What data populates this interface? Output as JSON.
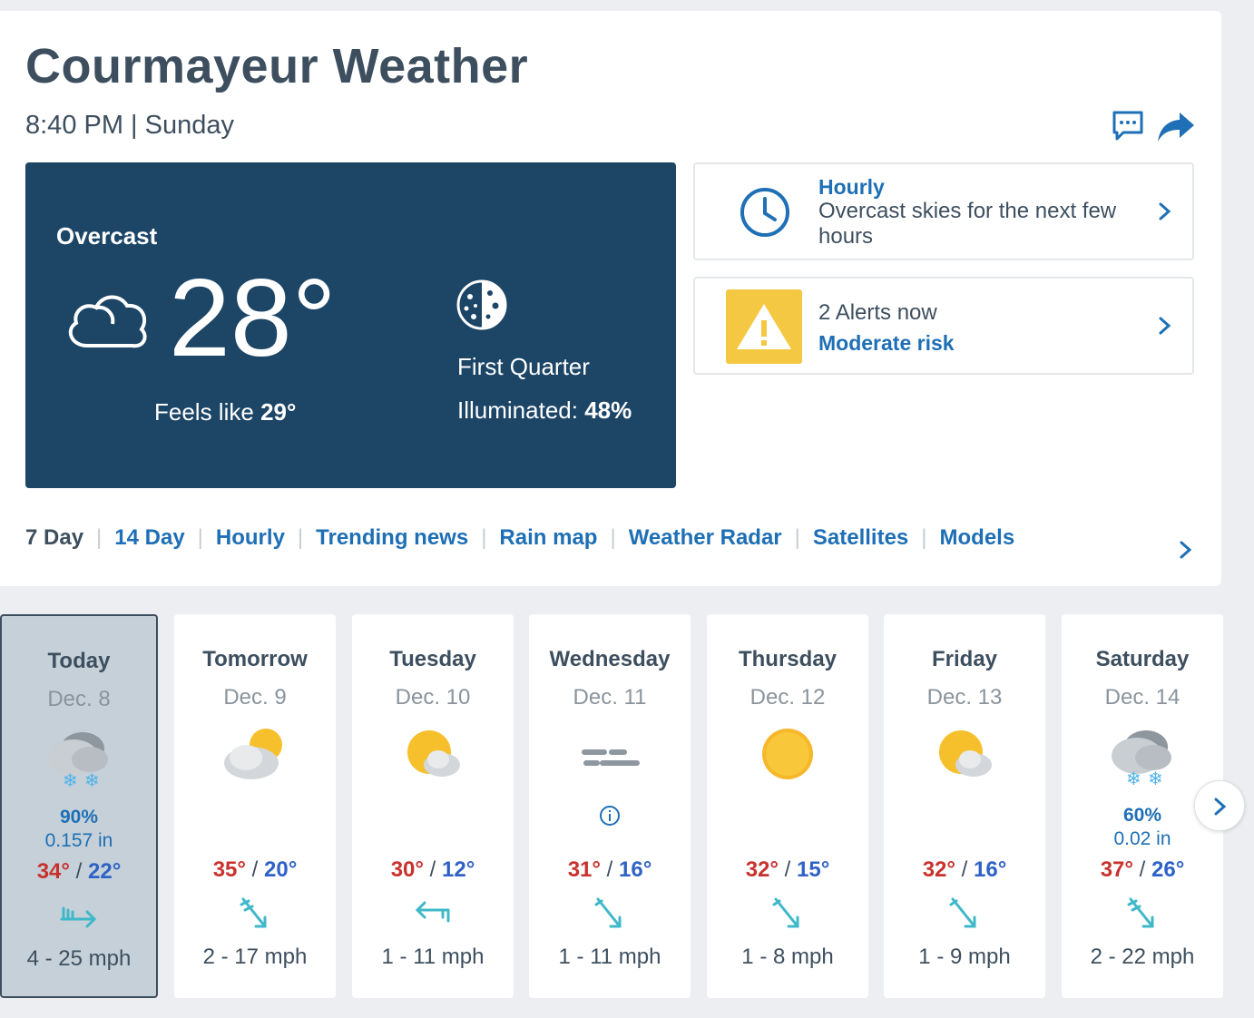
{
  "header": {
    "title": "Courmayeur Weather",
    "time_line": "8:40 PM | Sunday"
  },
  "current": {
    "condition": "Overcast",
    "temperature": "28°",
    "feels_like_label": "Feels like",
    "feels_like_value": "29°",
    "moon_phase": "First Quarter",
    "illuminated_label": "Illuminated:",
    "illuminated_value": "48%"
  },
  "hourly_card": {
    "title": "Hourly",
    "description": "Overcast skies for the next few hours"
  },
  "alerts_card": {
    "count_text": "2 Alerts now",
    "risk_text": "Moderate risk"
  },
  "tabs": [
    "7 Day",
    "14 Day",
    "Hourly",
    "Trending news",
    "Rain map",
    "Weather Radar",
    "Satellites",
    "Models"
  ],
  "forecast": [
    {
      "day": "Today",
      "date": "Dec. 8",
      "icon": "snow-cloud-icon",
      "precip_pct": "90%",
      "precip_amt": "0.157 in",
      "hi": "34°",
      "lo": "22°",
      "wind": "4 - 25 mph"
    },
    {
      "day": "Tomorrow",
      "date": "Dec. 9",
      "icon": "partly-cloudy-icon",
      "hi": "35°",
      "lo": "20°",
      "wind": "2 - 17 mph"
    },
    {
      "day": "Tuesday",
      "date": "Dec. 10",
      "icon": "sun-cloud-icon",
      "hi": "30°",
      "lo": "12°",
      "wind": "1 - 11 mph"
    },
    {
      "day": "Wednesday",
      "date": "Dec. 11",
      "icon": "fog-icon",
      "hi": "31°",
      "lo": "16°",
      "wind": "1 - 11 mph"
    },
    {
      "day": "Thursday",
      "date": "Dec. 12",
      "icon": "sun-icon",
      "hi": "32°",
      "lo": "15°",
      "wind": "1 - 8 mph"
    },
    {
      "day": "Friday",
      "date": "Dec. 13",
      "icon": "sun-cloud-icon",
      "hi": "32°",
      "lo": "16°",
      "wind": "1 - 9 mph"
    },
    {
      "day": "Saturday",
      "date": "Dec. 14",
      "icon": "snow-cloud-icon",
      "precip_pct": "60%",
      "precip_amt": "0.02 in",
      "hi": "37°",
      "lo": "26°",
      "wind": "2 - 22 mph"
    }
  ],
  "colors": {
    "panel": "#1c4566",
    "link": "#1e6fb5",
    "high_temp": "#c8322e",
    "low_temp": "#2f62c6",
    "alert": "#f4c842",
    "wind_arrow": "#3fb8c9"
  }
}
